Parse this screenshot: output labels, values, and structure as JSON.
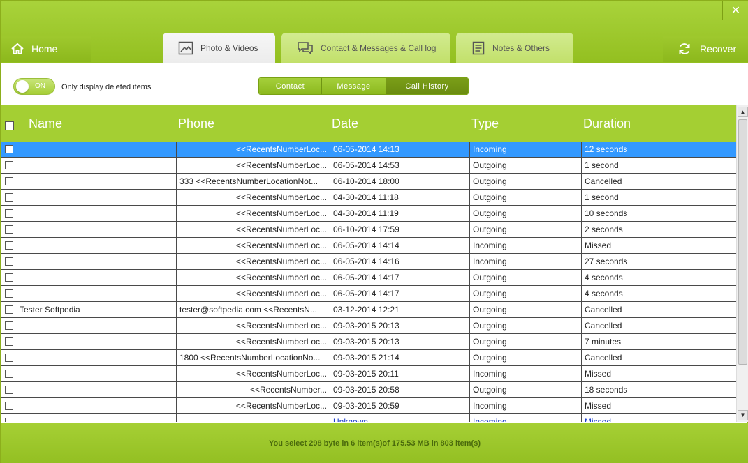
{
  "window": {
    "minimize_glyph": "_",
    "close_glyph": "✕"
  },
  "nav": {
    "home_label": "Home",
    "recover_label": "Recover",
    "tabs": [
      {
        "label": "Photo & Videos",
        "icon": "photo-icon"
      },
      {
        "label": "Contact & Messages & Call log",
        "icon": "chat-icon"
      },
      {
        "label": "Notes & Others",
        "icon": "notes-icon"
      }
    ]
  },
  "toolbar": {
    "toggle_state": "ON",
    "toggle_caption": "Only display deleted items",
    "segments": [
      "Contact",
      "Message",
      "Call History"
    ],
    "active_segment": "Call History"
  },
  "table": {
    "columns": [
      "Name",
      "Phone",
      "Date",
      "Type",
      "Duration"
    ],
    "rows": [
      {
        "name": "",
        "phone": "<<RecentsNumberLoc...",
        "date": "06-05-2014 14:13",
        "type": "Incoming",
        "duration": "12 seconds",
        "selected": true
      },
      {
        "name": "",
        "phone": "<<RecentsNumberLoc...",
        "date": "06-05-2014 14:53",
        "type": "Outgoing",
        "duration": "1 second"
      },
      {
        "name": "",
        "phone": "333  <<RecentsNumberLocationNot...",
        "date": "06-10-2014 18:00",
        "type": "Outgoing",
        "duration": "Cancelled",
        "left": true
      },
      {
        "name": "",
        "phone": "<<RecentsNumberLoc...",
        "date": "04-30-2014 11:18",
        "type": "Outgoing",
        "duration": "1 second"
      },
      {
        "name": "",
        "phone": "<<RecentsNumberLoc...",
        "date": "04-30-2014 11:19",
        "type": "Outgoing",
        "duration": "10 seconds"
      },
      {
        "name": "",
        "phone": "<<RecentsNumberLoc...",
        "date": "06-10-2014 17:59",
        "type": "Outgoing",
        "duration": "2 seconds"
      },
      {
        "name": "",
        "phone": "<<RecentsNumberLoc...",
        "date": "06-05-2014 14:14",
        "type": "Incoming",
        "duration": "Missed"
      },
      {
        "name": "",
        "phone": "<<RecentsNumberLoc...",
        "date": "06-05-2014 14:16",
        "type": "Incoming",
        "duration": "27 seconds"
      },
      {
        "name": "",
        "phone": "<<RecentsNumberLoc...",
        "date": "06-05-2014 14:17",
        "type": "Outgoing",
        "duration": "4 seconds"
      },
      {
        "name": "",
        "phone": "<<RecentsNumberLoc...",
        "date": "06-05-2014 14:17",
        "type": "Outgoing",
        "duration": "4 seconds"
      },
      {
        "name": "Tester Softpedia",
        "phone": "tester@softpedia.com  <<RecentsN...",
        "date": "03-12-2014 12:21",
        "type": "Outgoing",
        "duration": "Cancelled",
        "left": true
      },
      {
        "name": "",
        "phone": "<<RecentsNumberLoc...",
        "date": "09-03-2015 20:13",
        "type": "Outgoing",
        "duration": "Cancelled"
      },
      {
        "name": "",
        "phone": "<<RecentsNumberLoc...",
        "date": "09-03-2015 20:13",
        "type": "Outgoing",
        "duration": "7 minutes"
      },
      {
        "name": "",
        "phone": "1800  <<RecentsNumberLocationNo...",
        "date": "09-03-2015 21:14",
        "type": "Outgoing",
        "duration": "Cancelled",
        "left": true
      },
      {
        "name": "",
        "phone": "<<RecentsNumberLoc...",
        "date": "09-03-2015 20:11",
        "type": "Incoming",
        "duration": "Missed"
      },
      {
        "name": "",
        "phone": "<<RecentsNumber...",
        "date": "09-03-2015 20:58",
        "type": "Outgoing",
        "duration": "18 seconds"
      },
      {
        "name": "",
        "phone": "<<RecentsNumberLoc...",
        "date": "09-03-2015 20:59",
        "type": "Incoming",
        "duration": "Missed"
      },
      {
        "name": "",
        "phone": "",
        "date": "Unknown",
        "type": "Incoming",
        "duration": "Missed",
        "partial": true
      }
    ]
  },
  "status": {
    "text": "You select 298 byte in 6 item(s)of 175.53 MB in 803 item(s)"
  },
  "colors": {
    "accent": "#a4cf33",
    "selection": "#3399ff"
  }
}
